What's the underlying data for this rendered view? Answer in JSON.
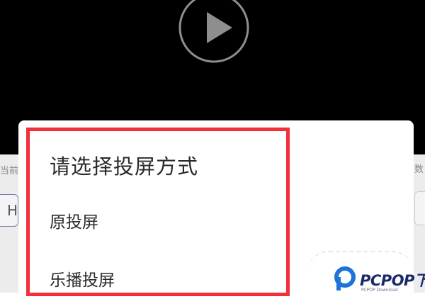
{
  "dialog": {
    "title": "请选择投屏方式",
    "options": [
      {
        "label": "原投屏"
      },
      {
        "label": "乐播投屏"
      }
    ]
  },
  "background": {
    "left_text": "当前",
    "right_text": "数",
    "left_button_label": "H"
  },
  "watermark": {
    "brand": "PCPOP下载",
    "subtitle": "PCPOP Download",
    "brand_color": "#1a2a6a",
    "accent_color": "#1e73d8"
  },
  "highlight_color": "#f22f3a",
  "icons": {
    "play": "play-icon",
    "logo": "pcpop-logo-icon"
  }
}
